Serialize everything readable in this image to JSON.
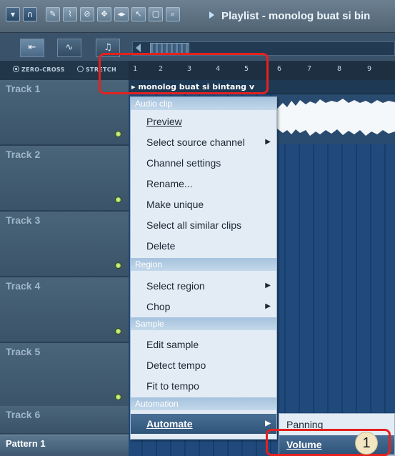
{
  "window": {
    "title": "Playlist - monolog buat si bin",
    "toolbar_icons": [
      "menu-arrow-icon",
      "magnet-icon",
      "pencil-icon",
      "brush-icon",
      "mute-icon",
      "slip-icon",
      "slice-icon",
      "select-icon",
      "zoom-icon",
      "playback-icon"
    ]
  },
  "toolbar_row2": {
    "modes": [
      "audio-tab",
      "automation-tab",
      "pattern-tab"
    ]
  },
  "options": {
    "zero_cross": "ZERO-CROSS",
    "stretch": "STRETCH"
  },
  "ruler": {
    "ticks": [
      "1",
      "2",
      "3",
      "4",
      "5",
      "6",
      "7",
      "8",
      "9"
    ]
  },
  "tracks": [
    "Track 1",
    "Track 2",
    "Track 3",
    "Track 4",
    "Track 5",
    "Track 6"
  ],
  "patterns": [
    "Pattern 1"
  ],
  "clip": {
    "name": "monolog buat si bintang v"
  },
  "context_menu": {
    "sections": {
      "audio_clip": "Audio clip",
      "region": "Region",
      "sample": "Sample",
      "automation": "Automation"
    },
    "items": {
      "preview": "Preview",
      "select_source_channel": "Select source channel",
      "channel_settings": "Channel settings",
      "rename": "Rename...",
      "make_unique": "Make unique",
      "select_all_similar": "Select all similar clips",
      "delete": "Delete",
      "select_region": "Select region",
      "chop": "Chop",
      "edit_sample": "Edit sample",
      "detect_tempo": "Detect tempo",
      "fit_to_tempo": "Fit to tempo",
      "automate": "Automate"
    }
  },
  "submenu": {
    "panning": "Panning",
    "volume": "Volume"
  },
  "callout": {
    "number": "1"
  },
  "colors": {
    "highlight_box": "#e4211f",
    "menu_bg": "#e3ecf5",
    "menu_highlight": "#2f5478",
    "grid_blue": "#204a7c"
  }
}
